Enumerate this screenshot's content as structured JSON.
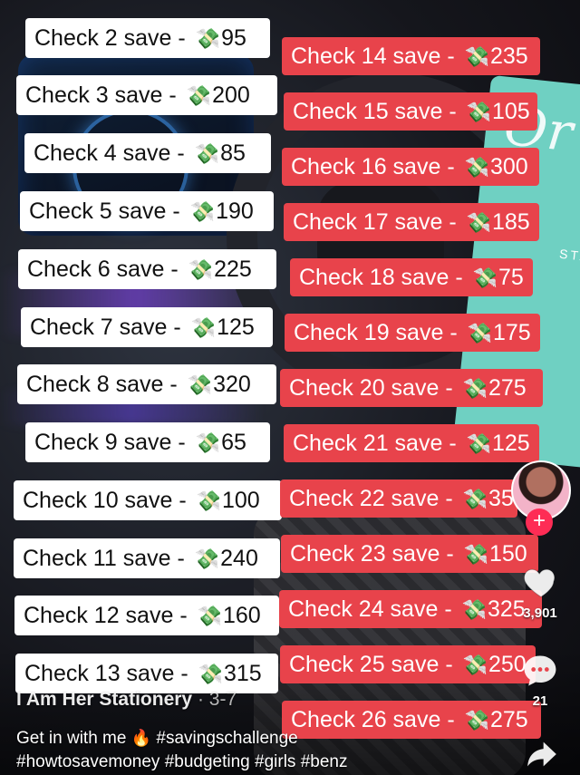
{
  "checks_white": [
    {
      "label": "Check 2 save - ",
      "icon": "money-icon",
      "amount": "95"
    },
    {
      "label": "Check 3 save - ",
      "icon": "money-icon",
      "amount": "200"
    },
    {
      "label": "Check 4 save - ",
      "icon": "money-icon",
      "amount": "85"
    },
    {
      "label": "Check 5 save - ",
      "icon": "money-icon",
      "amount": "190"
    },
    {
      "label": "Check 6 save - ",
      "icon": "money-icon",
      "amount": "225"
    },
    {
      "label": "Check 7 save - ",
      "icon": "money-icon",
      "amount": "125"
    },
    {
      "label": "Check 8 save - ",
      "icon": "money-icon",
      "amount": "320"
    },
    {
      "label": "Check 9 save - ",
      "icon": "money-icon",
      "amount": "65"
    },
    {
      "label": "Check 10 save - ",
      "icon": "money-icon",
      "amount": "100"
    },
    {
      "label": "Check 11 save - ",
      "icon": "money-icon",
      "amount": "240"
    },
    {
      "label": "Check 12 save - ",
      "icon": "money-icon",
      "amount": "160"
    },
    {
      "label": "Check 13 save - ",
      "icon": "money-icon",
      "amount": "315"
    }
  ],
  "checks_red": [
    {
      "label": "Check 14 save - ",
      "icon": "money-icon",
      "amount": "235"
    },
    {
      "label": "Check 15 save - ",
      "icon": "money-icon",
      "amount": "105"
    },
    {
      "label": "Check 16 save - ",
      "icon": "money-icon",
      "amount": "300"
    },
    {
      "label": "Check 17 save - ",
      "icon": "money-icon",
      "amount": "185"
    },
    {
      "label": "Check 18 save - ",
      "icon": "money-icon",
      "amount": "75"
    },
    {
      "label": "Check 19 save - ",
      "icon": "money-icon",
      "amount": "175"
    },
    {
      "label": "Check 20 save - ",
      "icon": "money-icon",
      "amount": "275"
    },
    {
      "label": "Check 21 save - ",
      "icon": "money-icon",
      "amount": "125"
    },
    {
      "label": "Check 22 save - ",
      "icon": "money-icon",
      "amount": "35"
    },
    {
      "label": "Check 23 save - ",
      "icon": "money-icon",
      "amount": "150"
    },
    {
      "label": "Check 24 save - ",
      "icon": "money-icon",
      "amount": "325"
    },
    {
      "label": "Check 25 save - ",
      "icon": "money-icon",
      "amount": "250"
    },
    {
      "label": "Check 26 save - ",
      "icon": "money-icon",
      "amount": "275"
    }
  ],
  "background": {
    "book_title": "Or",
    "book_subtitle": "STA"
  },
  "profile": {
    "follow_icon": "plus-icon"
  },
  "actions": {
    "likes": "3,901",
    "comments": "21",
    "like_icon": "heart-icon",
    "comment_icon": "comment-icon",
    "share_icon": "share-icon"
  },
  "caption": {
    "username": "I Am Her Stationery",
    "date": " · 3-7",
    "line1_prefix": "Get in with me ",
    "line1_emoji": "🔥",
    "line1_tag": " #savingschallenge",
    "line2": "#howtosavemoney #budgeting #girls #benz"
  },
  "colors": {
    "red_label": "#e8434b",
    "white_label": "#ffffff",
    "follow": "#fe2c55"
  }
}
